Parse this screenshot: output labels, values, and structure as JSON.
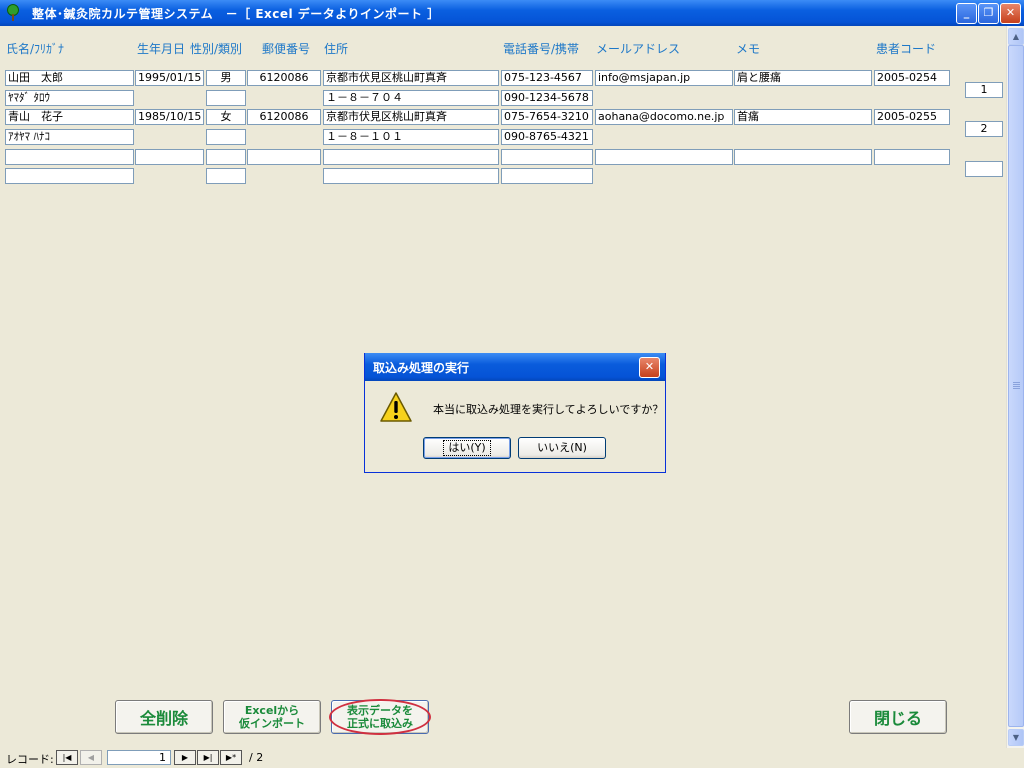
{
  "window": {
    "title": "整体･鍼灸院カルテ管理システム　－［ Excel データよりインポート ］",
    "minimize_icon": "minimize-icon",
    "restore_icon": "restore-icon",
    "close_icon": "close-icon"
  },
  "columns": {
    "name": "氏名/ﾌﾘｶﾞﾅ",
    "birthdate": "生年月日",
    "gender_type": "性別/類別",
    "postal": "郵便番号",
    "address": "住所",
    "phone": "電話番号/携帯",
    "email": "メールアドレス",
    "memo": "メモ",
    "patient_code": "患者コード"
  },
  "records": [
    {
      "name": "山田　太郎",
      "kana": "ﾔﾏﾀﾞ ﾀﾛｳ",
      "birthdate": "1995/01/15",
      "gender": "男",
      "type": "",
      "postal": "6120086",
      "address1": "京都市伏見区桃山町真斉",
      "address2": "１－８－７０４",
      "phone": "075-123-4567",
      "mobile": "090-1234-5678",
      "email": "info@msjapan.jp",
      "memo": "肩と腰痛",
      "patient_code": "2005-0254",
      "row_number": "1"
    },
    {
      "name": "青山　花子",
      "kana": "ｱｵﾔﾏ ﾊﾅｺ",
      "birthdate": "1985/10/15",
      "gender": "女",
      "type": "",
      "postal": "6120086",
      "address1": "京都市伏見区桃山町真斉",
      "address2": "１－８－１０１",
      "phone": "075-7654-3210",
      "mobile": "090-8765-4321",
      "email": "aohana@docomo.ne.jp",
      "memo": "首痛",
      "patient_code": "2005-0255",
      "row_number": "2"
    }
  ],
  "buttons": {
    "delete_all": "全削除",
    "excel_import_line1": "Excelから",
    "excel_import_line2": "仮インポート",
    "commit_line1": "表示データを",
    "commit_line2": "正式に取込み",
    "close": "閉じる"
  },
  "navigation": {
    "label": "レコード:",
    "current": "1",
    "total": "/ 2"
  },
  "dialog": {
    "title": "取込み処理の実行",
    "message": "本当に取込み処理を実行してよろしいですか？",
    "yes": "はい(Y)",
    "no": "いいえ(N)",
    "icon": "warning-icon"
  },
  "colors": {
    "header_text": "#1E78C8",
    "button_text": "#1A8A3A",
    "titlebar": "#0553D6",
    "highlight": "#D03040"
  }
}
